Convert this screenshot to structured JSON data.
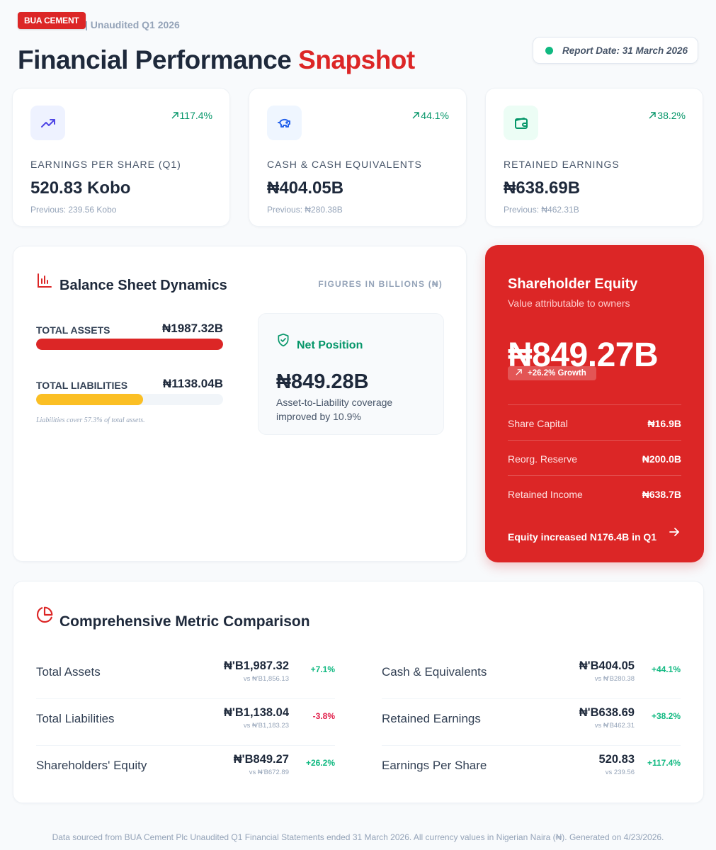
{
  "header": {
    "brand": "BUA CEMENT",
    "period": "| Unaudited Q1 2026",
    "title_main": "Financial Performance",
    "title_accent": "Snapshot",
    "report_date": "Report Date: 31 March 2026"
  },
  "kpis": [
    {
      "trend": "117.4%",
      "label": "EARNINGS PER SHARE (Q1)",
      "value": "520.83 Kobo",
      "previous": "Previous: 239.56 Kobo",
      "icon": "trending-up-icon"
    },
    {
      "trend": "44.1%",
      "label": "CASH & CASH EQUIVALENTS",
      "value": "₦404.05B",
      "previous": "Previous: ₦280.38B",
      "icon": "piggy-bank-icon"
    },
    {
      "trend": "38.2%",
      "label": "RETAINED EARNINGS",
      "value": "₦638.69B",
      "previous": "Previous: ₦462.31B",
      "icon": "wallet-icon"
    }
  ],
  "balance": {
    "title": "Balance Sheet Dynamics",
    "note": "FIGURES IN BILLIONS (₦)",
    "assets_label": "TOTAL ASSETS",
    "assets_value": "₦1987.32B",
    "assets_fill": 100,
    "liabilities_label": "TOTAL LIABILITIES",
    "liabilities_value": "₦1138.04B",
    "liabilities_fill": 57.3,
    "footnote": "Liabilities cover 57.3% of total assets.",
    "net_title": "Net Position",
    "net_value": "₦849.28B",
    "net_desc": "Asset-to-Liability coverage improved by 10.9%"
  },
  "equity": {
    "title": "Shareholder Equity",
    "subtitle": "Value attributable to owners",
    "value": "₦849.27B",
    "growth": "+26.2% Growth",
    "rows": [
      {
        "label": "Share Capital",
        "value": "₦16.9B"
      },
      {
        "label": "Reorg. Reserve",
        "value": "₦200.0B"
      },
      {
        "label": "Retained Income",
        "value": "₦638.7B"
      }
    ],
    "footer": "Equity increased N176.4B in Q1"
  },
  "comparison": {
    "title": "Comprehensive Metric Comparison",
    "left": [
      {
        "name": "Total Assets",
        "value": "₦'B1,987.32",
        "vs": "vs ₦'B1,856.13",
        "change": "+7.1%",
        "direction": "pos"
      },
      {
        "name": "Total Liabilities",
        "value": "₦'B1,138.04",
        "vs": "vs ₦'B1,183.23",
        "change": "-3.8%",
        "direction": "neg"
      },
      {
        "name": "Shareholders' Equity",
        "value": "₦'B849.27",
        "vs": "vs ₦'B672.89",
        "change": "+26.2%",
        "direction": "pos"
      }
    ],
    "right": [
      {
        "name": "Cash & Equivalents",
        "value": "₦'B404.05",
        "vs": "vs ₦'B280.38",
        "change": "+44.1%",
        "direction": "pos"
      },
      {
        "name": "Retained Earnings",
        "value": "₦'B638.69",
        "vs": "vs ₦'B462.31",
        "change": "+38.2%",
        "direction": "pos"
      },
      {
        "name": "Earnings Per Share",
        "value": "520.83",
        "vs": "vs 239.56",
        "change": "+117.4%",
        "direction": "pos"
      }
    ]
  },
  "footer": "Data sourced from BUA Cement Plc Unaudited Q1 Financial Statements ended 31 March 2026. All currency values in Nigerian Naira (₦). Generated on 4/23/2026.",
  "colors": {
    "brand_red": "#dc2626",
    "positive_green": "#10b981",
    "negative_red": "#e11d48",
    "liabilities_yellow": "#fbbf24",
    "navy_text": "#1e293b"
  }
}
